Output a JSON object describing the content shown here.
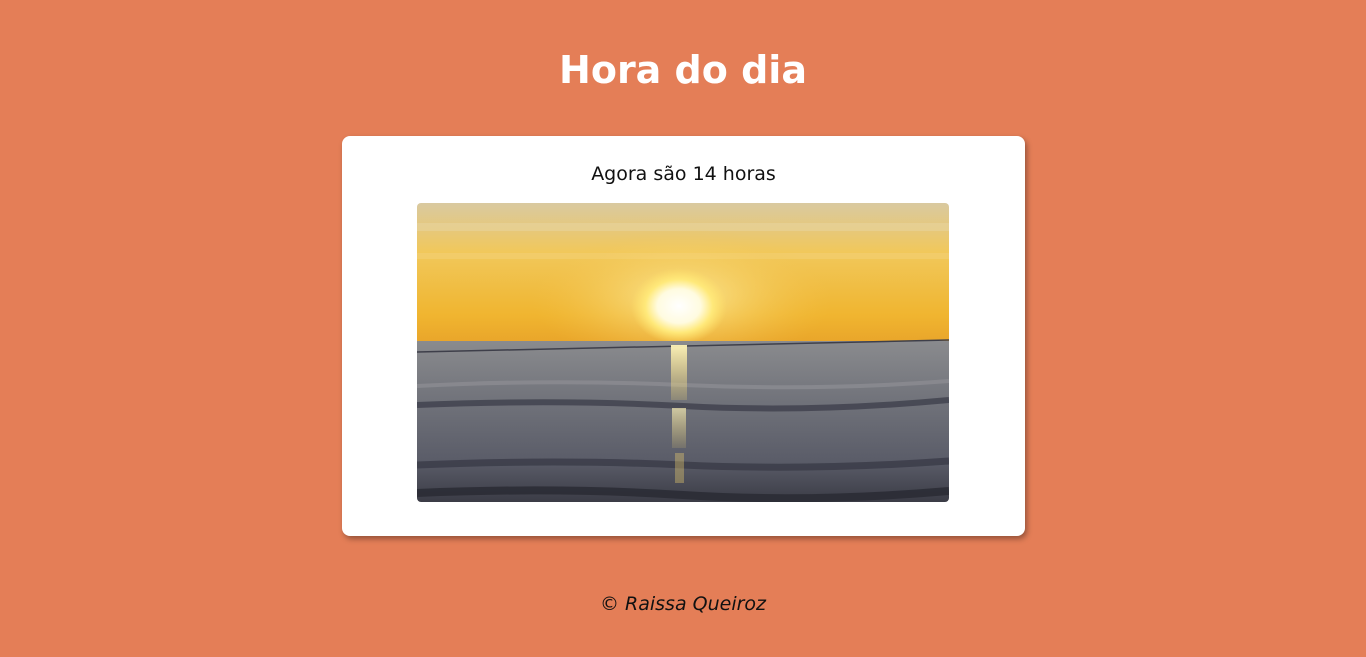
{
  "header": {
    "title": "Hora do dia"
  },
  "main": {
    "hour_message": "Agora são 14 horas",
    "image_icon": "sunset-over-sea-photo"
  },
  "footer": {
    "text": "© Raissa Queiroz"
  },
  "colors": {
    "background": "#e47e57",
    "card": "#ffffff",
    "title": "#ffffff"
  }
}
